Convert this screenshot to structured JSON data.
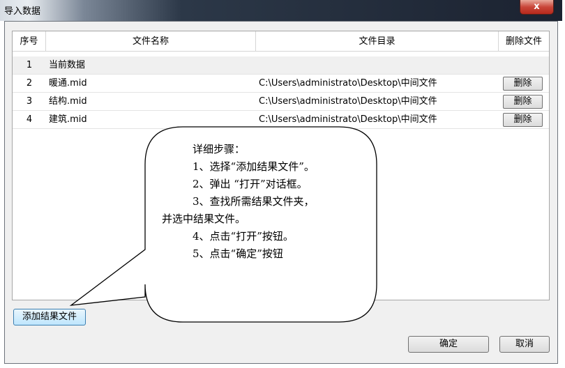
{
  "window": {
    "title": "导入数据",
    "close_label": "x"
  },
  "table": {
    "headers": [
      "序号",
      "文件名称",
      "文件目录",
      "删除文件"
    ],
    "rows": [
      {
        "index": "1",
        "name": "当前数据",
        "path": "",
        "action": ""
      },
      {
        "index": "2",
        "name": "暖通.mid",
        "path": "C:\\Users\\administrato\\Desktop\\中间文件",
        "action": "删除"
      },
      {
        "index": "3",
        "name": "结构.mid",
        "path": "C:\\Users\\administrato\\Desktop\\中间文件",
        "action": "删除"
      },
      {
        "index": "4",
        "name": "建筑.mid",
        "path": "C:\\Users\\administrato\\Desktop\\中间文件",
        "action": "删除"
      }
    ]
  },
  "buttons": {
    "add": "添加结果文件",
    "ok": "确定",
    "cancel": "取消"
  },
  "callout": {
    "lines": [
      "详细步骤：",
      "1、选择“添加结果文件”。",
      "2、弹出 “打开”对话框。",
      "3、查找所需结果文件夹，",
      "并选中结果文件。",
      "4、点击“打开”按钮。",
      "5、点击“确定”按钮"
    ]
  }
}
